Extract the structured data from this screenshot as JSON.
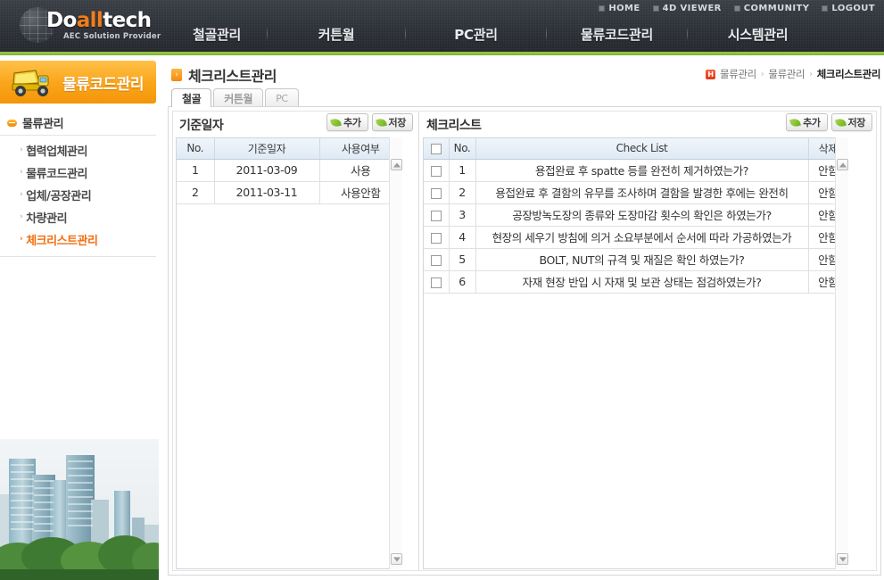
{
  "header": {
    "logo_name": "Doalltech",
    "logo_accent_start": 2,
    "logo_accent_end": 5,
    "logo_tagline": "AEC Solution Provider",
    "util_nav": [
      {
        "label": "HOME"
      },
      {
        "label": "4D VIEWER"
      },
      {
        "label": "COMMUNITY"
      },
      {
        "label": "LOGOUT"
      }
    ],
    "main_nav": [
      {
        "label": "철골관리"
      },
      {
        "label": "커튼월"
      },
      {
        "label": "PC관리"
      },
      {
        "label": "물류코드관리"
      },
      {
        "label": "시스템관리"
      }
    ],
    "accent_color": "#f07d1a",
    "green_bar_color": "#7fb233"
  },
  "sidebar": {
    "banner_title": "물류코드관리",
    "banner_icon": "dump-truck-icon",
    "group_label": "물류관리",
    "items": [
      {
        "label": "협력업체관리",
        "active": false
      },
      {
        "label": "물류코드관리",
        "active": false
      },
      {
        "label": "업체/공장관리",
        "active": false
      },
      {
        "label": "차량관리",
        "active": false
      },
      {
        "label": "체크리스트관리",
        "active": true
      }
    ],
    "active_color": "#f26f10",
    "photo_caption": "city-skyline-photo"
  },
  "page": {
    "title": "체크리스트관리",
    "breadcrumb": {
      "home_icon": "home-icon",
      "items": [
        "물류관리",
        "물류관리",
        "체크리스트관리"
      ],
      "separator": "›"
    },
    "tabs": [
      {
        "label": "철골",
        "active": true
      },
      {
        "label": "커튼월",
        "active": false
      },
      {
        "label": "PC",
        "active": false
      }
    ]
  },
  "left_panel": {
    "title": "기준일자",
    "buttons": [
      {
        "label": "추가",
        "icon": "leaf-icon"
      },
      {
        "label": "저장",
        "icon": "leaf-icon"
      }
    ],
    "columns": [
      "No.",
      "기준일자",
      "사용여부"
    ],
    "rows": [
      {
        "no": "1",
        "date": "2011-03-09",
        "use": "사용"
      },
      {
        "no": "2",
        "date": "2011-03-11",
        "use": "사용안함"
      }
    ],
    "scroll": {
      "up_icon": "arrow-up-icon",
      "down_icon": "arrow-down-icon"
    }
  },
  "right_panel": {
    "title": "체크리스트",
    "buttons": [
      {
        "label": "추가",
        "icon": "leaf-icon"
      },
      {
        "label": "저장",
        "icon": "leaf-icon"
      }
    ],
    "columns": [
      "",
      "No.",
      "Check List",
      "삭제"
    ],
    "rows": [
      {
        "checked": false,
        "no": "1",
        "text": "용접완료 후 spatte 등를 완전히 제거하였는가?",
        "delete": "안함"
      },
      {
        "checked": false,
        "no": "2",
        "text": "용접완료 후 결함의 유무를 조사하며 결함을 발경한 후에는 완전히",
        "delete": "안함"
      },
      {
        "checked": false,
        "no": "3",
        "text": "공장방녹도장의 종류와 도장마감 횟수의 확인은 하였는가?",
        "delete": "안함"
      },
      {
        "checked": false,
        "no": "4",
        "text": "현장의 세우기 방침에 의거 소요부분에서 순서에 따라 가공하였는가",
        "delete": "안함"
      },
      {
        "checked": false,
        "no": "5",
        "text": "BOLT, NUT의 규격 및 재질은 확인 하였는가?",
        "delete": "안함"
      },
      {
        "checked": false,
        "no": "6",
        "text": "자재 현장 반입 시 자재 및 보관 상태는 점검하였는가?",
        "delete": "안함"
      }
    ],
    "scroll": {
      "up_icon": "arrow-up-icon",
      "down_icon": "arrow-down-icon"
    }
  }
}
